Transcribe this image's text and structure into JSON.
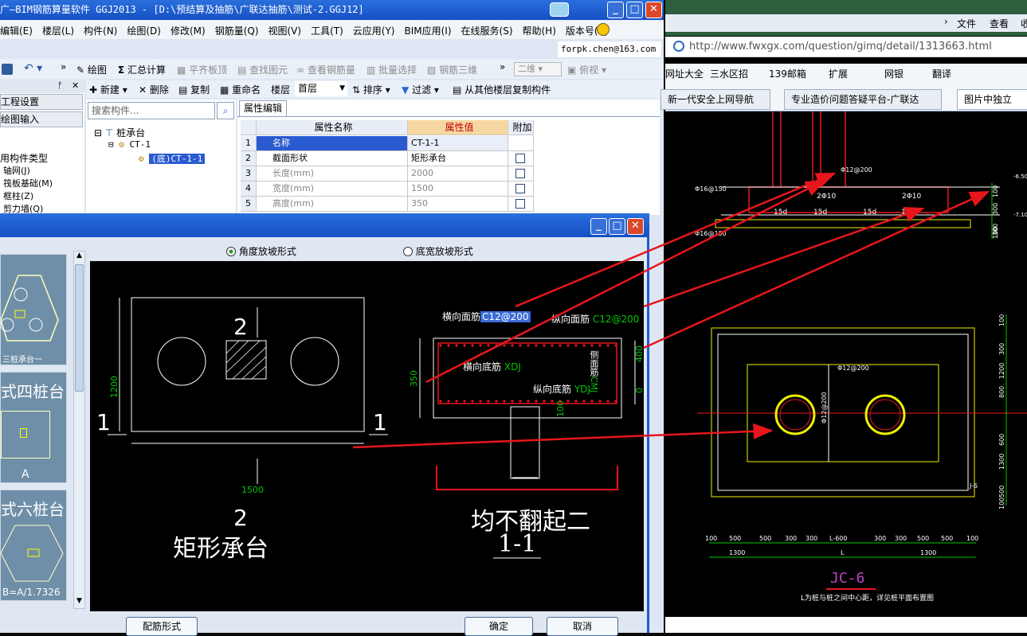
{
  "app": {
    "title": "广—BIM钢筋算量软件 GGJ2013 - [D:\\预结算及抽筋\\广联达抽筋\\测试-2.GGJ12]",
    "menu": [
      "编辑(E)",
      "楼层(L)",
      "构件(N)",
      "绘图(D)",
      "修改(M)",
      "钢筋量(Q)",
      "视图(V)",
      "工具(T)",
      "云应用(Y)",
      "BIM应用(I)",
      "在线服务(S)",
      "帮助(H)",
      "版本号(B)"
    ],
    "account": "forpk.chen@163.com",
    "toolbar1": {
      "draw": "绘图",
      "sum": "汇总计算",
      "flat": "平齐板顶",
      "find": "查找图元",
      "view_rebar": "查看钢筋量",
      "batch": "批量选择",
      "rebar3d": "钢筋三维",
      "view2d": "二维",
      "view_mode": "俯视"
    },
    "toolbar2": {
      "new": "新建",
      "delete": "删除",
      "copy": "复制",
      "rename": "重命名",
      "floor_label": "楼层",
      "floor_value": "首层",
      "sort": "排序",
      "filter": "过滤",
      "copy_from": "从其他楼层复制构件"
    },
    "left_nav": {
      "project": "工程设置",
      "draw_input": "绘图输入",
      "common_types": "用构件类型",
      "items": [
        "轴网(J)",
        "筏板基础(M)",
        "框柱(Z)",
        "剪力墙(Q)"
      ]
    },
    "search_placeholder": "搜索构件...",
    "tree": {
      "root": "桩承台",
      "child": "CT-1",
      "leaf": "(底)CT-1-1"
    },
    "props": {
      "tab": "属性编辑",
      "headers": [
        "属性名称",
        "属性值",
        "附加"
      ],
      "rows": [
        {
          "n": "1",
          "name": "名称",
          "value": "CT-1-1"
        },
        {
          "n": "2",
          "name": "截面形状",
          "value": "矩形承台"
        },
        {
          "n": "3",
          "name": "长度(mm)",
          "value": "2000"
        },
        {
          "n": "4",
          "name": "宽度(mm)",
          "value": "1500"
        },
        {
          "n": "5",
          "name": "高度(mm)",
          "value": "350"
        }
      ]
    }
  },
  "dialog": {
    "radio1": "角度放坡形式",
    "radio2": "底宽放坡形式",
    "thumbs": [
      {
        "label": "三桩承台一"
      },
      {
        "label": "式四桩台",
        "sub": "A"
      },
      {
        "label": "式六桩台",
        "sub": "B=A/1.7326"
      }
    ],
    "cad": {
      "sec2_top": "2",
      "sec2_bot": "2",
      "sec1_left": "1",
      "sec1_right": "1",
      "dim_1200": "1200",
      "dim_1500": "1500",
      "plan_name": "矩形承台",
      "top_trans": "横向面筋",
      "top_trans_val": "C12@200",
      "top_long": "纵向面筋",
      "top_long_val": "C12@200",
      "bot_trans": "横向底筋",
      "bot_trans_val": "XDJ",
      "bot_long": "纵向底筋",
      "bot_long_val": "YDJ",
      "side": "侧面筋",
      "side_val": "CMJ",
      "dim_350": "350",
      "dim_400": "400",
      "dim_0": "0",
      "dim_100": "100",
      "note": "均不翻起二",
      "sec_name": "1-1"
    },
    "btn_rebar": "配筋形式",
    "btn_ok": "确定",
    "btn_cancel": "取消"
  },
  "browser": {
    "nav": [
      "文件",
      "查看",
      "收"
    ],
    "url": "http://www.fwxgx.com/question/gimq/detail/1313663.html",
    "bookmarks": [
      "网址大全",
      "三水区招",
      "139邮箱",
      "扩展",
      "网银",
      "翻译"
    ],
    "tabs": [
      "新一代安全上网导航",
      "专业造价问题答疑平台-广联达",
      "图片中独立"
    ],
    "drawing_title": "JC-6",
    "drawing_note": "L为桩与桩之间中心距，详见桩平面布置图",
    "rebar_labels": [
      "Φ16@150",
      "Φ16@150",
      "Φ12@200",
      "Φ12@200",
      "Φ12@200",
      "2Φ10",
      "2Φ10"
    ],
    "hooks": [
      "15d",
      "15d",
      "15d",
      "15d"
    ],
    "levels": [
      "-6.50",
      "-7.10"
    ],
    "right_dims": [
      "100",
      "300",
      "300",
      "100"
    ],
    "right_dims2": [
      "100",
      "300",
      "1200",
      "800",
      "600",
      "1300",
      "500",
      "100"
    ],
    "bottom_dims": [
      "100",
      "500",
      "500",
      "300",
      "300",
      "L-600",
      "300",
      "300",
      "500",
      "500",
      "100"
    ],
    "bottom_totals": [
      "1300",
      "L",
      "1300"
    ],
    "mark": "J-6"
  },
  "colors": {
    "title": "#1a58d0",
    "cad_bg": "#000000",
    "red": "#e8161b",
    "green": "#00c800",
    "yellow": "#f0f000"
  }
}
